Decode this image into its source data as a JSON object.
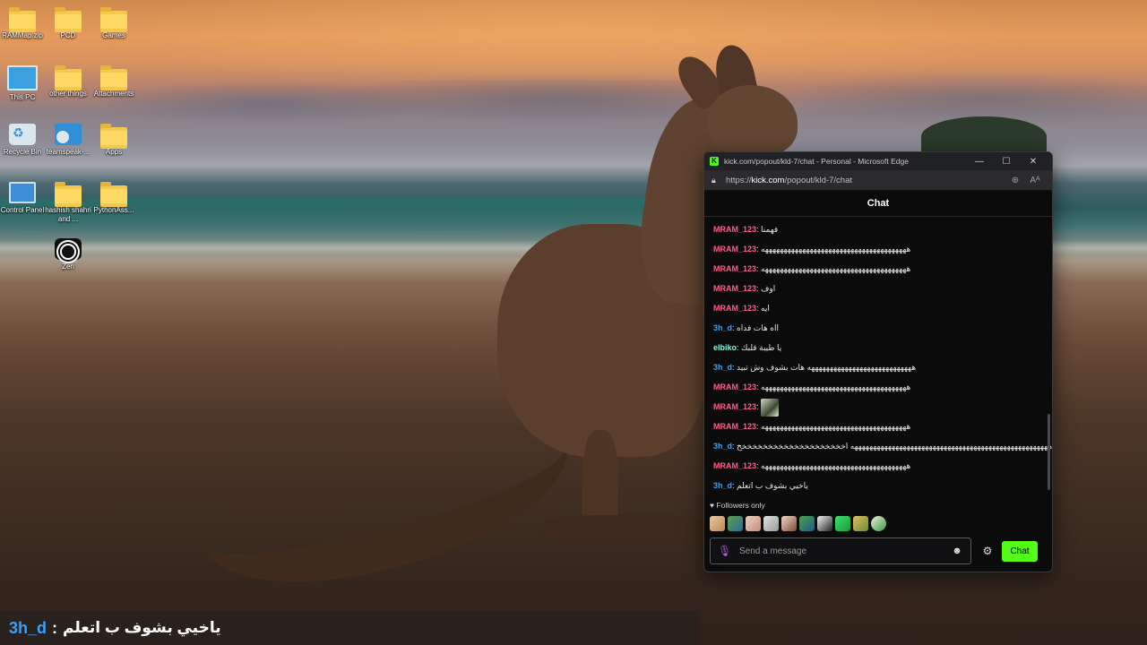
{
  "desktop": {
    "icons": [
      {
        "label": "RAMMap.zip",
        "type": "folder"
      },
      {
        "label": "PCD",
        "type": "folder"
      },
      {
        "label": "Games",
        "type": "folder"
      },
      {
        "label": "This PC",
        "type": "monitor"
      },
      {
        "label": "other things",
        "type": "folder"
      },
      {
        "label": "Attachments",
        "type": "folder"
      },
      {
        "label": "Recycle Bin",
        "type": "bin"
      },
      {
        "label": "teamspeak-...",
        "type": "disc"
      },
      {
        "label": "Apps",
        "type": "folder"
      },
      {
        "label": "Control Panel",
        "type": "cpanel"
      },
      {
        "label": "hashish shahri and ...",
        "type": "folder"
      },
      {
        "label": "PythonAss...",
        "type": "folder"
      },
      {
        "label": "Zen",
        "type": "zen"
      }
    ]
  },
  "browser": {
    "title": "kick.com/popout/kld-7/chat - Personal - Microsoft Edge",
    "url_prefix": "https://",
    "url_host": "kick.com",
    "url_path": "/popout/kld-7/chat",
    "controls": {
      "minimize": "—",
      "maximize": "☐",
      "close": "✕"
    }
  },
  "chat": {
    "header": "Chat",
    "messages": [
      {
        "user": "MRAM_123",
        "color": "#ff5c8a",
        "text": "فهمنا"
      },
      {
        "user": "MRAM_123",
        "color": "#ff5c8a",
        "text": "هههههههههههههههههههههههههههههههههههههههه"
      },
      {
        "user": "MRAM_123",
        "color": "#ff5c8a",
        "text": "هههههههههههههههههههههههههههههههههههههههه"
      },
      {
        "user": "MRAM_123",
        "color": "#ff5c8a",
        "text": "اوف"
      },
      {
        "user": "MRAM_123",
        "color": "#ff5c8a",
        "text": "ايه"
      },
      {
        "user": "3h_d",
        "color": "#3aa0ff",
        "text": "ااه هات فداه"
      },
      {
        "user": "elbiko",
        "color": "#8ff0d8",
        "text": "يا طيبة قلبك"
      },
      {
        "user": "3h_d",
        "color": "#3aa0ff",
        "text": "ههههههههههههههههههههههههههههه هات بشوف وش تبيد"
      },
      {
        "user": "MRAM_123",
        "color": "#ff5c8a",
        "text": "هههههههههههههههههههههههههههههههههههههههه"
      },
      {
        "user": "MRAM_123",
        "color": "#ff5c8a",
        "text": "",
        "emote": "frog-emote"
      },
      {
        "user": "MRAM_123",
        "color": "#ff5c8a",
        "text": "هههههههههههههههههههههههههههههههههههههههه"
      },
      {
        "user": "3h_d",
        "color": "#3aa0ff",
        "text": "هههههههههههههههههههههههههههههههههههههههههههههههههههههه اخخخخخخخخخخخخخخخخخخخخخ"
      },
      {
        "user": "MRAM_123",
        "color": "#ff5c8a",
        "text": "هههههههههههههههههههههههههههههههههههههههه"
      },
      {
        "user": "3h_d",
        "color": "#3aa0ff",
        "text": "ياخيي بشوف ب اتعلم"
      }
    ],
    "followers_only": "Followers only",
    "emotes": [
      "cat-emote",
      "pepe-emote",
      "cat-emote",
      "cat-emote",
      "girl-emote",
      "pepe-emote",
      "speaker-emote",
      "green-emote",
      "box-emote",
      "frog-emote"
    ],
    "input_placeholder": "Send a message",
    "send_label": "Chat",
    "accent": "#53fc18"
  },
  "overlay": {
    "user": "3h_d",
    "separator": ":",
    "text": "ياخيي بشوف ب اتعلم"
  }
}
